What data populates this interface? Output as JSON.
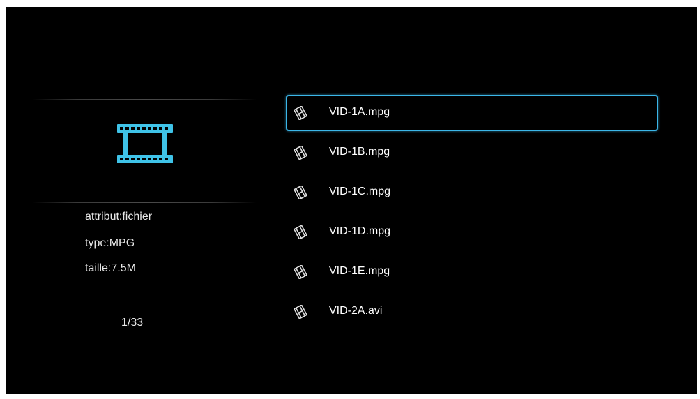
{
  "preview": {
    "icon": "film-strip-icon",
    "icon_color": "#3fc3e8"
  },
  "info": {
    "attribute": "attribut:fichier",
    "type": "type:MPG",
    "size": "taille:7.5M"
  },
  "counter": "1/33",
  "files": [
    {
      "name": "VID-1A.mpg",
      "icon": "film-icon",
      "selected": true
    },
    {
      "name": "VID-1B.mpg",
      "icon": "film-icon",
      "selected": false
    },
    {
      "name": "VID-1C.mpg",
      "icon": "film-icon",
      "selected": false
    },
    {
      "name": "VID-1D.mpg",
      "icon": "film-icon",
      "selected": false
    },
    {
      "name": "VID-1E.mpg",
      "icon": "film-icon",
      "selected": false
    },
    {
      "name": "VID-2A.avi",
      "icon": "film-icon",
      "selected": false
    }
  ],
  "colors": {
    "background": "#000000",
    "selection_border": "#3cb6e8",
    "text": "#ffffff"
  }
}
